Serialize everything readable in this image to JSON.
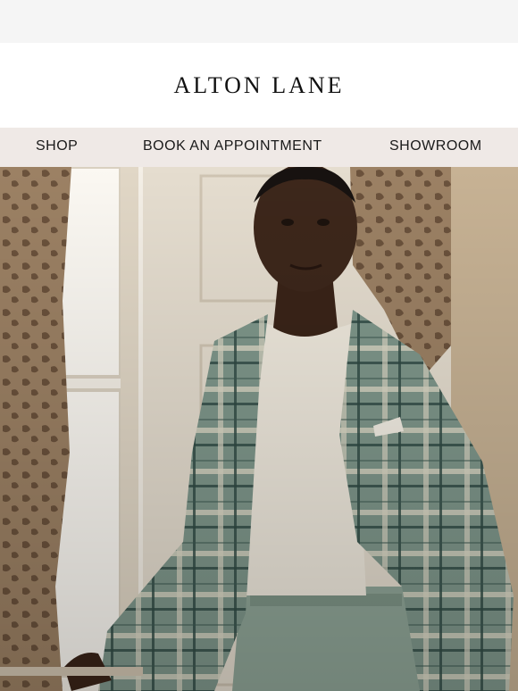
{
  "brand": {
    "logo_text": "ALTON LANE"
  },
  "nav": {
    "items": [
      {
        "label": "SHOP"
      },
      {
        "label": "BOOK AN APPOINTMENT"
      },
      {
        "label": "SHOWROOM"
      }
    ]
  },
  "hero": {
    "image": "man-in-plaid-blazer-by-window",
    "colors": {
      "blazer": "#6f8a7e",
      "shirt": "#efe9dd",
      "trousers": "#8fa597",
      "curtain": "#8a6f55",
      "door": "#e7dfd2"
    }
  }
}
